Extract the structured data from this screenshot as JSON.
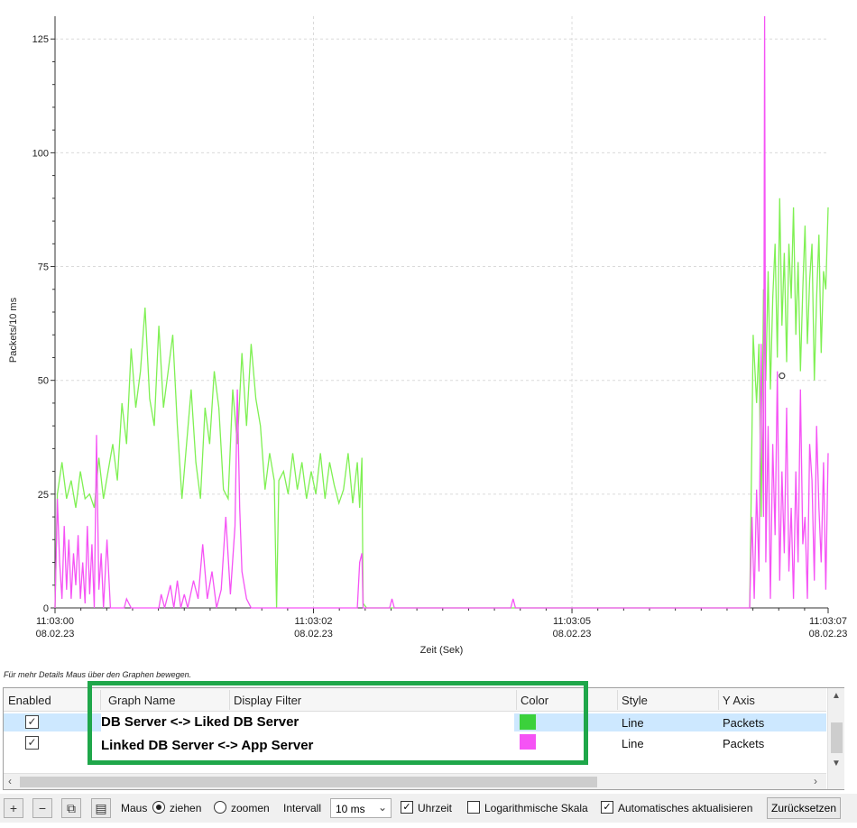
{
  "chart_data": {
    "type": "line",
    "ylabel": "Packets/10 ms",
    "xlabel": "Zeit (Sek)",
    "y_ticks": [
      "0",
      "25",
      "50",
      "75",
      "100",
      "125"
    ],
    "ylim": [
      0,
      130
    ],
    "x_ticks": [
      {
        "time": "11:03:00",
        "date": "08.02.23"
      },
      {
        "time": "11:03:02",
        "date": "08.02.23"
      },
      {
        "time": "11:03:05",
        "date": "08.02.23"
      },
      {
        "time": "11:03:07",
        "date": "08.02.23"
      }
    ],
    "xlim": [
      0,
      6.7
    ],
    "grid": true,
    "series": [
      {
        "name": "DB Server <-> Liked DB Server",
        "color": "#7ff053",
        "points": [
          [
            0,
            0
          ],
          [
            0.02,
            25
          ],
          [
            0.06,
            32
          ],
          [
            0.1,
            24
          ],
          [
            0.14,
            28
          ],
          [
            0.18,
            22
          ],
          [
            0.22,
            30
          ],
          [
            0.26,
            24
          ],
          [
            0.3,
            25
          ],
          [
            0.34,
            22
          ],
          [
            0.38,
            33
          ],
          [
            0.42,
            24
          ],
          [
            0.46,
            30
          ],
          [
            0.5,
            36
          ],
          [
            0.54,
            28
          ],
          [
            0.58,
            45
          ],
          [
            0.62,
            36
          ],
          [
            0.66,
            57
          ],
          [
            0.7,
            44
          ],
          [
            0.74,
            52
          ],
          [
            0.78,
            66
          ],
          [
            0.82,
            46
          ],
          [
            0.86,
            40
          ],
          [
            0.9,
            62
          ],
          [
            0.94,
            44
          ],
          [
            0.98,
            52
          ],
          [
            1.02,
            60
          ],
          [
            1.06,
            40
          ],
          [
            1.1,
            24
          ],
          [
            1.14,
            36
          ],
          [
            1.18,
            48
          ],
          [
            1.22,
            32
          ],
          [
            1.26,
            24
          ],
          [
            1.3,
            44
          ],
          [
            1.34,
            36
          ],
          [
            1.38,
            52
          ],
          [
            1.42,
            44
          ],
          [
            1.46,
            26
          ],
          [
            1.5,
            24
          ],
          [
            1.54,
            48
          ],
          [
            1.58,
            36
          ],
          [
            1.62,
            56
          ],
          [
            1.66,
            40
          ],
          [
            1.7,
            58
          ],
          [
            1.74,
            46
          ],
          [
            1.78,
            40
          ],
          [
            1.82,
            26
          ],
          [
            1.86,
            34
          ],
          [
            1.9,
            28
          ],
          [
            1.92,
            0
          ],
          [
            1.94,
            28
          ],
          [
            1.98,
            30
          ],
          [
            2.02,
            25
          ],
          [
            2.06,
            34
          ],
          [
            2.1,
            26
          ],
          [
            2.14,
            32
          ],
          [
            2.18,
            24
          ],
          [
            2.22,
            30
          ],
          [
            2.26,
            25
          ],
          [
            2.3,
            34
          ],
          [
            2.34,
            24
          ],
          [
            2.38,
            32
          ],
          [
            2.42,
            27
          ],
          [
            2.46,
            23
          ],
          [
            2.5,
            26
          ],
          [
            2.54,
            34
          ],
          [
            2.58,
            23
          ],
          [
            2.62,
            32
          ],
          [
            2.64,
            22
          ],
          [
            2.66,
            33
          ],
          [
            2.67,
            1
          ],
          [
            2.7,
            0
          ],
          [
            6.02,
            0
          ],
          [
            6.03,
            18
          ],
          [
            6.05,
            60
          ],
          [
            6.08,
            45
          ],
          [
            6.1,
            58
          ],
          [
            6.12,
            20
          ],
          [
            6.14,
            70
          ],
          [
            6.16,
            50
          ],
          [
            6.18,
            74
          ],
          [
            6.2,
            48
          ],
          [
            6.22,
            68
          ],
          [
            6.24,
            80
          ],
          [
            6.26,
            55
          ],
          [
            6.28,
            90
          ],
          [
            6.3,
            62
          ],
          [
            6.32,
            78
          ],
          [
            6.34,
            54
          ],
          [
            6.36,
            80
          ],
          [
            6.38,
            68
          ],
          [
            6.4,
            88
          ],
          [
            6.42,
            60
          ],
          [
            6.44,
            76
          ],
          [
            6.46,
            52
          ],
          [
            6.48,
            70
          ],
          [
            6.5,
            84
          ],
          [
            6.52,
            58
          ],
          [
            6.54,
            72
          ],
          [
            6.56,
            80
          ],
          [
            6.58,
            50
          ],
          [
            6.6,
            68
          ],
          [
            6.62,
            82
          ],
          [
            6.64,
            56
          ],
          [
            6.66,
            74
          ],
          [
            6.68,
            70
          ],
          [
            6.7,
            88
          ]
        ]
      },
      {
        "name": "Linked DB Server <-> App Server",
        "color": "#f553f5",
        "points": [
          [
            0,
            0
          ],
          [
            0.02,
            24
          ],
          [
            0.04,
            10
          ],
          [
            0.06,
            2
          ],
          [
            0.08,
            18
          ],
          [
            0.1,
            4
          ],
          [
            0.12,
            15
          ],
          [
            0.14,
            2
          ],
          [
            0.16,
            12
          ],
          [
            0.18,
            5
          ],
          [
            0.2,
            16
          ],
          [
            0.22,
            2
          ],
          [
            0.24,
            10
          ],
          [
            0.26,
            1
          ],
          [
            0.28,
            18
          ],
          [
            0.3,
            3
          ],
          [
            0.32,
            14
          ],
          [
            0.34,
            0
          ],
          [
            0.36,
            38
          ],
          [
            0.38,
            4
          ],
          [
            0.4,
            12
          ],
          [
            0.42,
            0
          ],
          [
            0.45,
            15
          ],
          [
            0.48,
            0
          ],
          [
            0.6,
            0
          ],
          [
            0.62,
            2
          ],
          [
            0.66,
            0
          ],
          [
            0.9,
            0
          ],
          [
            0.92,
            3
          ],
          [
            0.95,
            0
          ],
          [
            1.0,
            5
          ],
          [
            1.03,
            0
          ],
          [
            1.06,
            6
          ],
          [
            1.09,
            0
          ],
          [
            1.12,
            3
          ],
          [
            1.15,
            0
          ],
          [
            1.2,
            6
          ],
          [
            1.24,
            2
          ],
          [
            1.28,
            14
          ],
          [
            1.32,
            2
          ],
          [
            1.36,
            8
          ],
          [
            1.4,
            0
          ],
          [
            1.44,
            4
          ],
          [
            1.48,
            20
          ],
          [
            1.52,
            3
          ],
          [
            1.56,
            18
          ],
          [
            1.58,
            48
          ],
          [
            1.6,
            22
          ],
          [
            1.62,
            8
          ],
          [
            1.66,
            2
          ],
          [
            1.7,
            0
          ],
          [
            2.62,
            0
          ],
          [
            2.64,
            10
          ],
          [
            2.66,
            12
          ],
          [
            2.67,
            0
          ],
          [
            2.9,
            0
          ],
          [
            2.92,
            2
          ],
          [
            2.94,
            0
          ],
          [
            3.95,
            0
          ],
          [
            3.97,
            2
          ],
          [
            3.99,
            0
          ],
          [
            6.02,
            0
          ],
          [
            6.04,
            20
          ],
          [
            6.06,
            2
          ],
          [
            6.08,
            26
          ],
          [
            6.1,
            8
          ],
          [
            6.12,
            58
          ],
          [
            6.14,
            20
          ],
          [
            6.15,
            130
          ],
          [
            6.16,
            10
          ],
          [
            6.18,
            40
          ],
          [
            6.2,
            2
          ],
          [
            6.22,
            36
          ],
          [
            6.24,
            16
          ],
          [
            6.26,
            52
          ],
          [
            6.28,
            6
          ],
          [
            6.3,
            30
          ],
          [
            6.32,
            12
          ],
          [
            6.34,
            44
          ],
          [
            6.36,
            8
          ],
          [
            6.38,
            22
          ],
          [
            6.4,
            2
          ],
          [
            6.42,
            30
          ],
          [
            6.44,
            10
          ],
          [
            6.46,
            48
          ],
          [
            6.48,
            14
          ],
          [
            6.5,
            20
          ],
          [
            6.52,
            2
          ],
          [
            6.54,
            36
          ],
          [
            6.56,
            28
          ],
          [
            6.58,
            6
          ],
          [
            6.6,
            40
          ],
          [
            6.62,
            22
          ],
          [
            6.64,
            10
          ],
          [
            6.66,
            32
          ],
          [
            6.68,
            4
          ],
          [
            6.7,
            34
          ]
        ]
      }
    ]
  },
  "hint_text": "Für mehr Details Maus über den Graphen bewegen.",
  "table": {
    "headers": {
      "enabled": "Enabled",
      "graph_name": "Graph Name",
      "display_filter": "Display Filter",
      "color": "Color",
      "style": "Style",
      "y_axis": "Y Axis"
    },
    "rows": [
      {
        "enabled_mark": "✓",
        "name": "DB Server <-> Liked DB Server",
        "color": "#3bd13b",
        "style": "Line",
        "y_axis": "Packets"
      },
      {
        "enabled_mark": "✓",
        "name": "Linked DB Server <-> App Server",
        "color": "#f553f5",
        "style": "Line",
        "y_axis": "Packets"
      }
    ]
  },
  "toolbar": {
    "add": "+",
    "remove": "−",
    "copy": "⧉",
    "clear": "▤",
    "mouse_label": "Maus",
    "drag_label": "ziehen",
    "zoom_label": "zoomen",
    "interval_label": "Intervall",
    "interval_value": "10 ms",
    "time_of_day_label": "Uhrzeit",
    "time_of_day_mark": "✓",
    "log_scale_label": "Logarithmische Skala",
    "auto_update_label": "Automatisches aktualisieren",
    "auto_update_mark": "✓",
    "reset_label": "Zurücksetzen"
  },
  "icons": {
    "scroll_up": "▲",
    "scroll_down": "▼",
    "scroll_left": "‹",
    "scroll_right": "›",
    "select_chevron": "⌄"
  }
}
